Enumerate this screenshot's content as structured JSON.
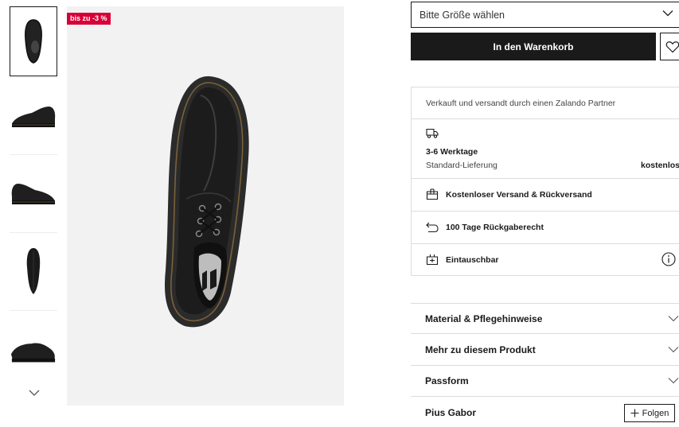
{
  "gallery": {
    "badge": "bis zu -3 %",
    "thumbnails": [
      "top-view",
      "side-view-left",
      "side-view-right",
      "sole-view",
      "angled-view"
    ]
  },
  "purchase": {
    "size_placeholder": "Bitte Größe wählen",
    "cart_label": "In den Warenkorb"
  },
  "info": {
    "seller": "Verkauft und versandt durch einen Zalando Partner",
    "delivery_time": "3-6 Werktage",
    "delivery_type": "Standard-Lieferung",
    "delivery_price": "kostenlos",
    "free_shipping": "Kostenloser Versand & Rückversand",
    "return_policy": "100 Tage Rückgaberecht",
    "exchange": "Eintauschbar"
  },
  "accordion": [
    "Material & Pflegehinweise",
    "Mehr zu diesem Produkt",
    "Passform"
  ],
  "brand": {
    "name": "Pius Gabor",
    "follow_label": "Folgen"
  },
  "colors": {
    "badge": "#d70036",
    "button": "#1a1a1a",
    "image_bg": "#f2f2f2"
  }
}
